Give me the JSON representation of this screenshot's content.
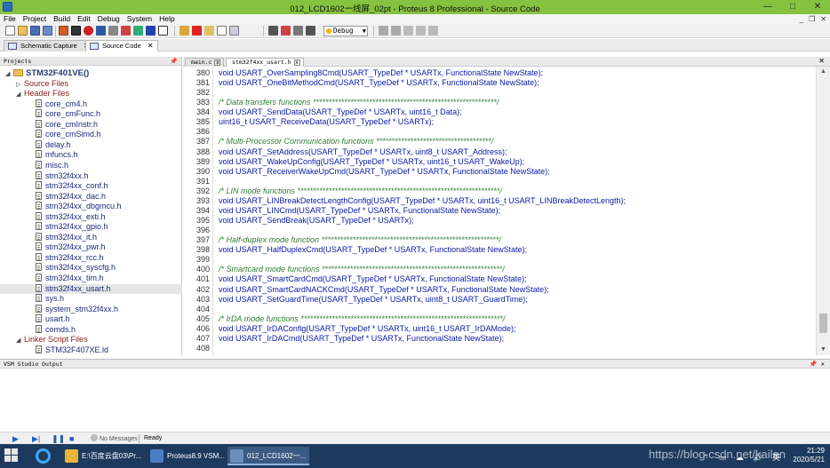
{
  "window": {
    "title": "012_LCD1602一线屏_02pt - Proteus 8 Professional - Source Code",
    "minimize": "—",
    "maximize": "□",
    "close": "✕"
  },
  "menu": {
    "items": [
      "File",
      "Project",
      "Build",
      "Edit",
      "Debug",
      "System",
      "Help"
    ],
    "mdi_min": "_",
    "mdi_restore": "❐",
    "mdi_close": "✕"
  },
  "toolbar": {
    "build_config": "Debug"
  },
  "app_tabs": [
    {
      "label": "Schematic Capture",
      "close": "✕"
    },
    {
      "label": "Source Code",
      "close": "✕"
    }
  ],
  "projects": {
    "header": "Projects",
    "pin": "📌",
    "root": "STM32F401VE()",
    "source_files": "Source Files",
    "header_files": "Header Files",
    "header_items": [
      "core_cm4.h",
      "core_cmFunc.h",
      "core_cmInstr.h",
      "core_cmSimd.h",
      "delay.h",
      "mfuncs.h",
      "misc.h",
      "stm32f4xx.h",
      "stm32f4xx_conf.h",
      "stm32f4xx_dac.h",
      "stm32f4xx_dbgmcu.h",
      "stm32f4xx_exti.h",
      "stm32f4xx_gpio.h",
      "stm32f4xx_it.h",
      "stm32f4xx_pwr.h",
      "stm32f4xx_rcc.h",
      "stm32f4xx_syscfg.h",
      "stm32f4xx_tim.h",
      "stm32f4xx_usart.h",
      "sys.h",
      "system_stm32f4xx.h",
      "usart.h",
      "comds.h"
    ],
    "linker_files": "Linker Script Files",
    "linker_items": [
      "STM32F407XE.ld"
    ]
  },
  "editor": {
    "tabs": [
      {
        "label": "main.c",
        "close": "x"
      },
      {
        "label": "stm32f4xx_usart.h",
        "close": "x"
      }
    ],
    "close": "✕",
    "lines": [
      {
        "n": "380",
        "t": "void USART_OverSampling8Cmd(USART_TypeDef * USARTx, FunctionalState NewState);"
      },
      {
        "n": "381",
        "t": "void USART_OneBitMethodCmd(USART_TypeDef * USARTx, FunctionalState NewState);"
      },
      {
        "n": "382",
        "t": ""
      },
      {
        "n": "383",
        "t": "/* Data transfers functions ***********************************************************/"
      },
      {
        "n": "384",
        "t": "void USART_SendData(USART_TypeDef * USARTx, uint16_t Data);"
      },
      {
        "n": "385",
        "t": "uint16_t USART_ReceiveData(USART_TypeDef * USARTx);"
      },
      {
        "n": "386",
        "t": ""
      },
      {
        "n": "387",
        "t": "/* Multi-Processor Communication functions *************************************/"
      },
      {
        "n": "388",
        "t": "void USART_SetAddress(USART_TypeDef * USARTx, uint8_t USART_Address);"
      },
      {
        "n": "389",
        "t": "void USART_WakeUpConfig(USART_TypeDef * USARTx, uint16_t USART_WakeUp);"
      },
      {
        "n": "390",
        "t": "void USART_ReceiverWakeUpCmd(USART_TypeDef * USARTx, FunctionalState NewState);"
      },
      {
        "n": "391",
        "t": ""
      },
      {
        "n": "392",
        "t": "/* LIN mode functions *****************************************************************/"
      },
      {
        "n": "393",
        "t": "void USART_LINBreakDetectLengthConfig(USART_TypeDef * USARTx, uint16_t USART_LINBreakDetectLength);"
      },
      {
        "n": "394",
        "t": "void USART_LINCmd(USART_TypeDef * USARTx, FunctionalState NewState);"
      },
      {
        "n": "395",
        "t": "void USART_SendBreak(USART_TypeDef * USARTx);"
      },
      {
        "n": "396",
        "t": ""
      },
      {
        "n": "397",
        "t": "/* Half-duplex mode function *********************************************************/"
      },
      {
        "n": "398",
        "t": "void USART_HalfDuplexCmd(USART_TypeDef * USARTx, FunctionalState NewState);"
      },
      {
        "n": "399",
        "t": ""
      },
      {
        "n": "400",
        "t": "/* Smartcard mode functions **********************************************************/"
      },
      {
        "n": "401",
        "t": "void USART_SmartCardCmd(USART_TypeDef * USARTx, FunctionalState NewState);"
      },
      {
        "n": "402",
        "t": "void USART_SmartCardNACKCmd(USART_TypeDef * USARTx, FunctionalState NewState);"
      },
      {
        "n": "403",
        "t": "void USART_SetGuardTime(USART_TypeDef * USARTx, uint8_t USART_GuardTime);"
      },
      {
        "n": "404",
        "t": ""
      },
      {
        "n": "405",
        "t": "/* IrDA mode functions *****************************************************************/"
      },
      {
        "n": "406",
        "t": "void USART_IrDAConfig(USART_TypeDef * USARTx, uint16_t USART_IrDAMode);"
      },
      {
        "n": "407",
        "t": "void USART_IrDACmd(USART_TypeDef * USARTx, FunctionalState NewState);"
      },
      {
        "n": "408",
        "t": ""
      }
    ]
  },
  "output": {
    "header": "VSM Studio Output",
    "pin": "📌"
  },
  "status": {
    "messages": "No Messages",
    "state": "Ready"
  },
  "taskbar": {
    "apps": [
      {
        "label": "E:\\百度云盘03\\Pr...",
        "color": "#e8b73a"
      },
      {
        "label": "Proteus8.9 VSM...",
        "color": "#4a7cc0"
      },
      {
        "label": "012_LCD1602一...",
        "color": "#6b8fb8"
      }
    ],
    "tray_icons": "⌃ ▭ ☁ 🔊 英",
    "time": "21:29",
    "date": "2020/5/21"
  },
  "watermark": "https://blog.csdn.net/kailen",
  "colors": {
    "titlebar": "#84c240",
    "comment": "#2e7d32",
    "code": "#0a1aa6",
    "taskbar": "#1d3a5e"
  }
}
